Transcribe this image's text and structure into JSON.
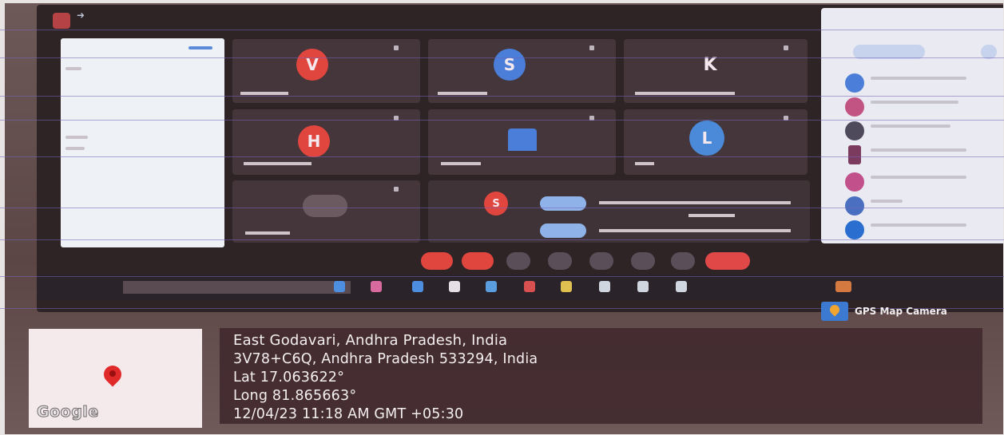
{
  "colors": {
    "avatar_v": "#e0453e",
    "avatar_s": "#4a7ed8",
    "avatar_h": "#e0453e",
    "avatar_l": "#4a8ad8",
    "end_call": "#e04848"
  },
  "meeting": {
    "tiles": [
      {
        "initial": "V"
      },
      {
        "initial": "S"
      },
      {
        "initial": "K"
      },
      {
        "initial": "H"
      },
      {
        "initial": ""
      },
      {
        "initial": "L"
      },
      {
        "initial": ""
      },
      {
        "initial": "S"
      }
    ]
  },
  "overlay": {
    "gps_badge_label": "GPS Map Camera",
    "map_logo_text": "Google",
    "location_line": "East Godavari, Andhra Pradesh, India",
    "address_line": "3V78+C6Q, Andhra Pradesh 533294, India",
    "lat_line": "Lat 17.063622°",
    "long_line": "Long 81.865663°",
    "datetime_line": "12/04/23 11:18 AM GMT +05:30"
  }
}
